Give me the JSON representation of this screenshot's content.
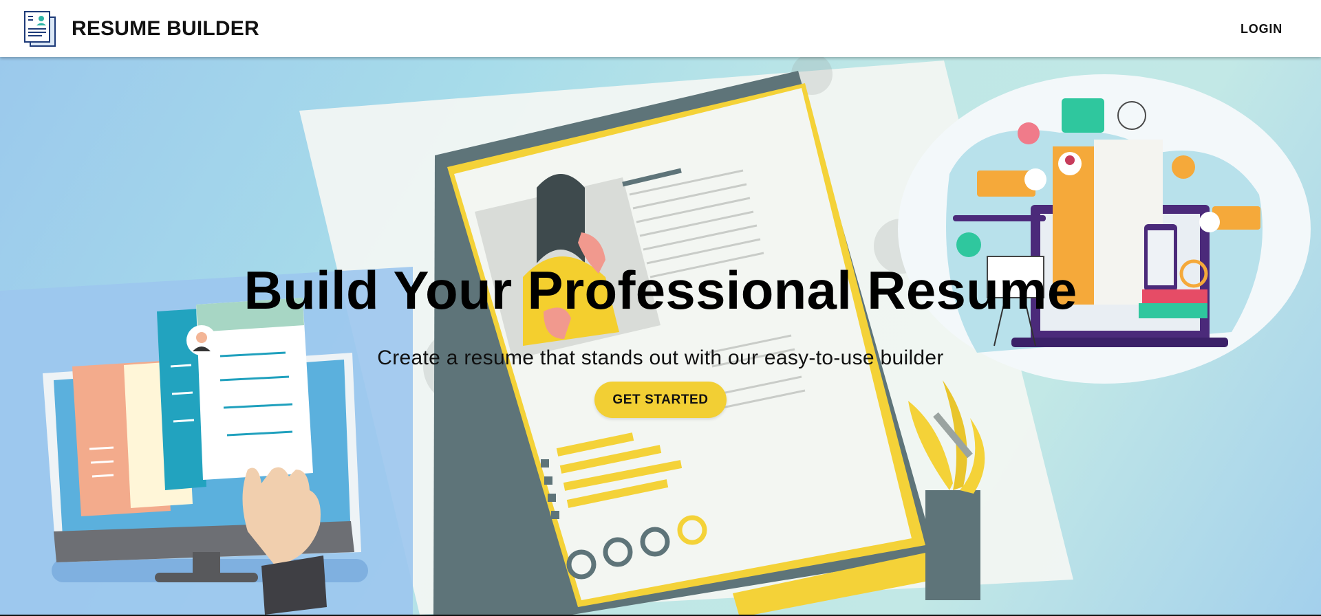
{
  "header": {
    "brand_title": "RESUME BUILDER",
    "logo_icon": "resume-document-icon",
    "login_label": "LOGIN"
  },
  "hero": {
    "title": "Build Your Professional Resume",
    "subtitle": "Create a resume that stands out with our easy-to-use builder",
    "cta_label": "GET STARTED"
  },
  "colors": {
    "accent": "#f2cf34",
    "header_bg": "#ffffff",
    "hero_bg_start": "#9bc9ec",
    "hero_bg_end": "#a3d0ec",
    "text": "#111111"
  }
}
